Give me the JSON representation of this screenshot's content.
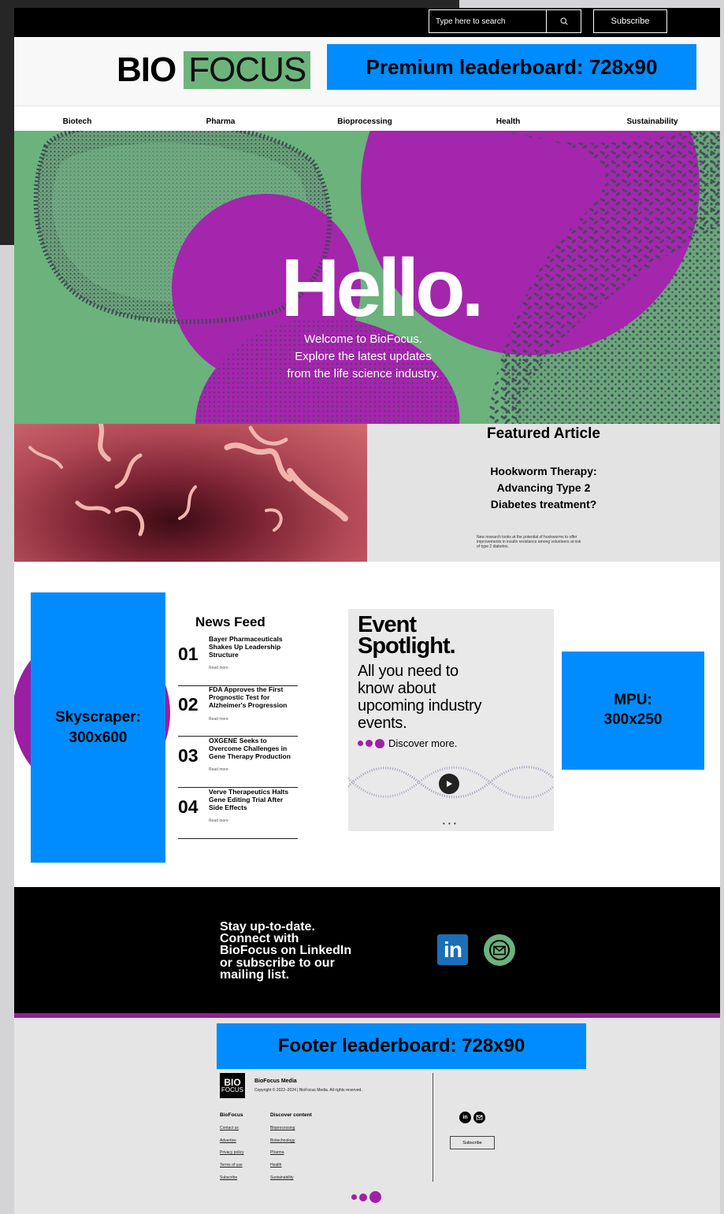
{
  "colors": {
    "brand_green": "#6db47c",
    "brand_purple": "#a020a8",
    "ad_blue": "#008cff",
    "black": "#000000",
    "footer_gray": "#e5e5e5"
  },
  "topbar": {
    "search_placeholder": "Type here to search",
    "search_icon": "search-icon",
    "subscribe_label": "Subscribe"
  },
  "header": {
    "logo_bio": "BIO",
    "logo_focus": "FOCUS",
    "premium_ad_label": "Premium leaderboard: 728x90"
  },
  "nav": {
    "items": [
      "Biotech",
      "Pharma",
      "Bioprocessing",
      "Health",
      "Sustainability"
    ]
  },
  "hero": {
    "title": "Hello.",
    "lines": [
      "Welcome to BioFocus.",
      "Explore the latest updates",
      "from the life science industry."
    ]
  },
  "featured": {
    "heading": "Featured Article",
    "title_lines": [
      "Hookworm Therapy:",
      "Advancing Type 2",
      "Diabetes treatment?"
    ],
    "description_lines": [
      "New research looks at the potential of hookworms to offer",
      "improvements in insulin resistance among volunteers at risk",
      "of type 2 diabetes."
    ]
  },
  "skyscraper_ad": {
    "line1": "Skyscraper:",
    "line2": "300x600"
  },
  "news_feed": {
    "title": "News Feed",
    "read_more": "Read more",
    "items": [
      {
        "number": "01",
        "headline": "Bayer Pharmaceuticals Shakes Up Leadership Structure"
      },
      {
        "number": "02",
        "headline": "FDA Approves the First Prognostic Test for Alzheimer's Progression"
      },
      {
        "number": "03",
        "headline": "OXGENE Seeks to Overcome Challenges in Gene Therapy Production"
      },
      {
        "number": "04",
        "headline": "Verve Therapeutics Halts Gene Editing Trial After Side Effects"
      }
    ]
  },
  "event_spotlight": {
    "title_line1": "Event",
    "title_line2": "Spotlight.",
    "body_lines": [
      "All you need to",
      "know about",
      "upcoming industry",
      "events."
    ],
    "discover": "Discover more.",
    "play_icon": "play-icon",
    "pager": "• • •"
  },
  "mpu_ad": {
    "line1": "MPU:",
    "line2": "300x250"
  },
  "connect": {
    "lines": [
      "Stay up-to-date.",
      "Connect with",
      "BioFocus on LinkedIn",
      "or subscribe to our",
      "mailing list."
    ],
    "linkedin_label": "in",
    "linkedin_icon": "linkedin-icon",
    "mail_icon": "mail-icon"
  },
  "footer": {
    "ad_label": "Footer leaderboard: 728x90",
    "logo_bio": "BIO",
    "logo_focus": "FOCUS",
    "brand": "BioFocus Media",
    "copyright": "Copyright © 2022–2024 | BioFocus Media. All rights reserved.",
    "col1_title": "BioFocus",
    "col1_links": [
      "Contact us",
      "Advertise",
      "Privacy policy",
      "Terms of use",
      "Subscribe"
    ],
    "col2_title": "Discover content",
    "col2_links": [
      "Bioprocessing",
      "Biotechnology",
      "Pharma",
      "Health",
      "Sustainability"
    ],
    "social_linkedin": "in",
    "subscribe_label": "Subscribe"
  }
}
